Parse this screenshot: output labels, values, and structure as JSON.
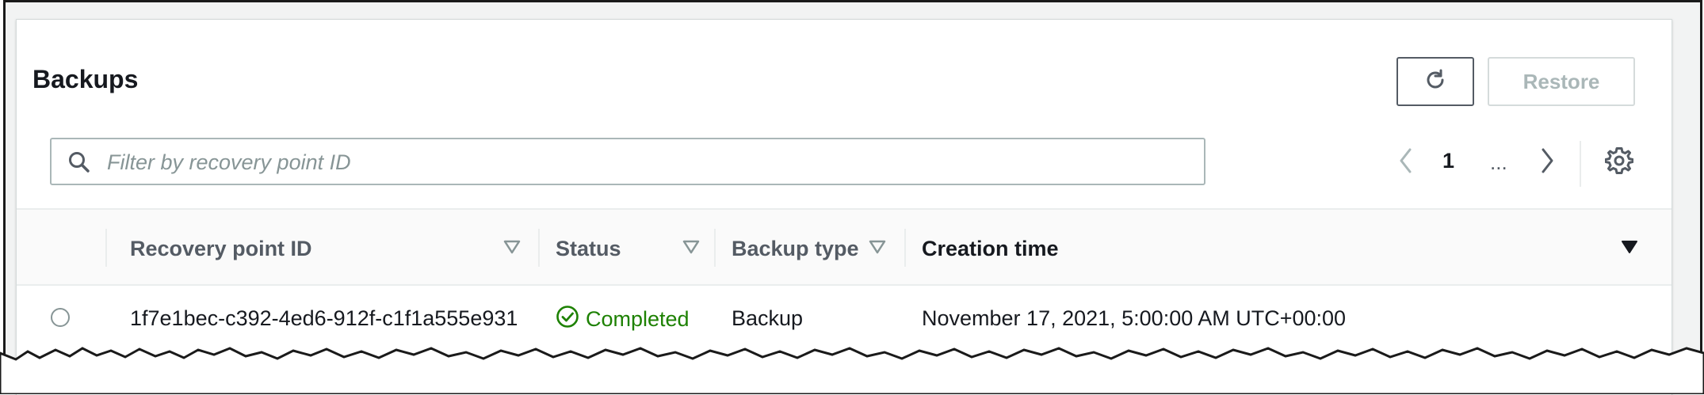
{
  "header": {
    "title": "Backups",
    "restore_label": "Restore"
  },
  "search": {
    "placeholder": "Filter by recovery point ID",
    "value": ""
  },
  "pagination": {
    "current_page": "1",
    "ellipsis": "..."
  },
  "table": {
    "columns": [
      {
        "label": "Recovery point ID",
        "sorted": false
      },
      {
        "label": "Status",
        "sorted": false
      },
      {
        "label": "Backup type",
        "sorted": false
      },
      {
        "label": "Creation time",
        "sorted": true,
        "direction": "descending"
      }
    ],
    "rows": [
      {
        "recovery_point_id": "1f7e1bec-c392-4ed6-912f-c1f1a555e931",
        "status": "Completed",
        "backup_type": "Backup",
        "creation_time": "November 17, 2021, 5:00:00 AM UTC+00:00",
        "selected": false
      }
    ]
  },
  "icons": {
    "refresh": "refresh-icon",
    "search": "search-icon",
    "prev": "chevron-left-icon",
    "next": "chevron-right-icon",
    "settings": "gear-icon",
    "status": "check-circle-icon"
  },
  "colors": {
    "success": "#1d8102",
    "disabled_text": "#aab7b8",
    "header_text": "#545b64",
    "border": "#d5dbdb"
  }
}
